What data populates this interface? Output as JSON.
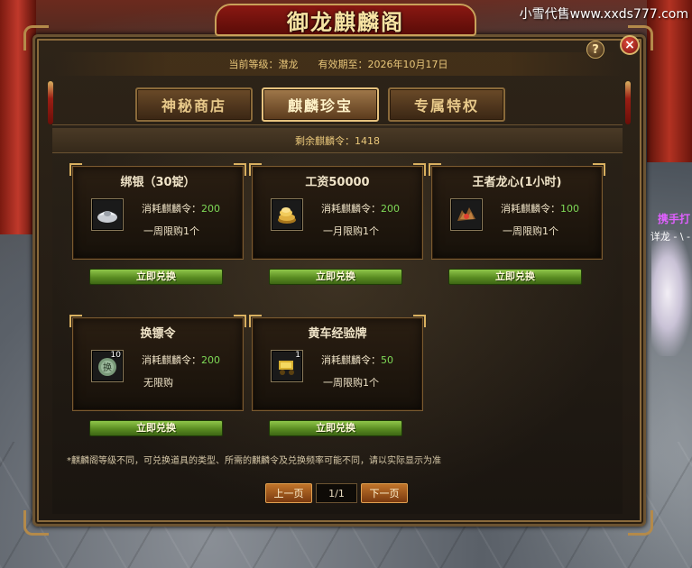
{
  "watermark": "小雪代售www.xxds777.com",
  "background": {
    "player_tag": "携手打",
    "player_name": "详龙 - \\ -"
  },
  "window": {
    "title": "御龙麒麟阁",
    "help_label": "?",
    "close_label": "×"
  },
  "header": {
    "level_text": "当前等级：潜龙",
    "expire_text": "有效期至：2026年10月17日"
  },
  "tabs": [
    {
      "label": "神秘商店",
      "active": false
    },
    {
      "label": "麒麟珍宝",
      "active": true
    },
    {
      "label": "专属特权",
      "active": false
    }
  ],
  "balance": {
    "text": "剩余麒麟令：1418"
  },
  "items": [
    {
      "title": "绑银（30锭）",
      "icon": "silver-ingot-icon",
      "count": "",
      "cost_label": "消耗麒麟令：",
      "cost_value": "200",
      "limit": "一周限购1个",
      "button": "立即兑换"
    },
    {
      "title": "工资50000",
      "icon": "gold-coins-icon",
      "count": "",
      "cost_label": "消耗麒麟令：",
      "cost_value": "200",
      "limit": "一月限购1个",
      "button": "立即兑换"
    },
    {
      "title": "王者龙心(1小时)",
      "icon": "dragon-heart-icon",
      "count": "",
      "cost_label": "消耗麒麟令：",
      "cost_value": "100",
      "limit": "一周限购1个",
      "button": "立即兑换"
    },
    {
      "title": "换镖令",
      "icon": "escort-token-icon",
      "count": "10",
      "cost_label": "消耗麒麟令：",
      "cost_value": "200",
      "limit": "无限购",
      "button": "立即兑换"
    },
    {
      "title": "黄车经验牌",
      "icon": "yellow-cart-icon",
      "count": "1",
      "cost_label": "消耗麒麟令：",
      "cost_value": "50",
      "limit": "一周限购1个",
      "button": "立即兑换"
    }
  ],
  "footnote": "*麒麟阁等级不同，可兑换道具的类型、所需的麒麟令及兑换频率可能不同，请以实际显示为准",
  "pager": {
    "prev": "上一页",
    "page": "1/1",
    "next": "下一页"
  },
  "colors": {
    "cost_number": "#7ed957",
    "gold_text": "#e9c77a",
    "button_green": "#5a8c22"
  }
}
